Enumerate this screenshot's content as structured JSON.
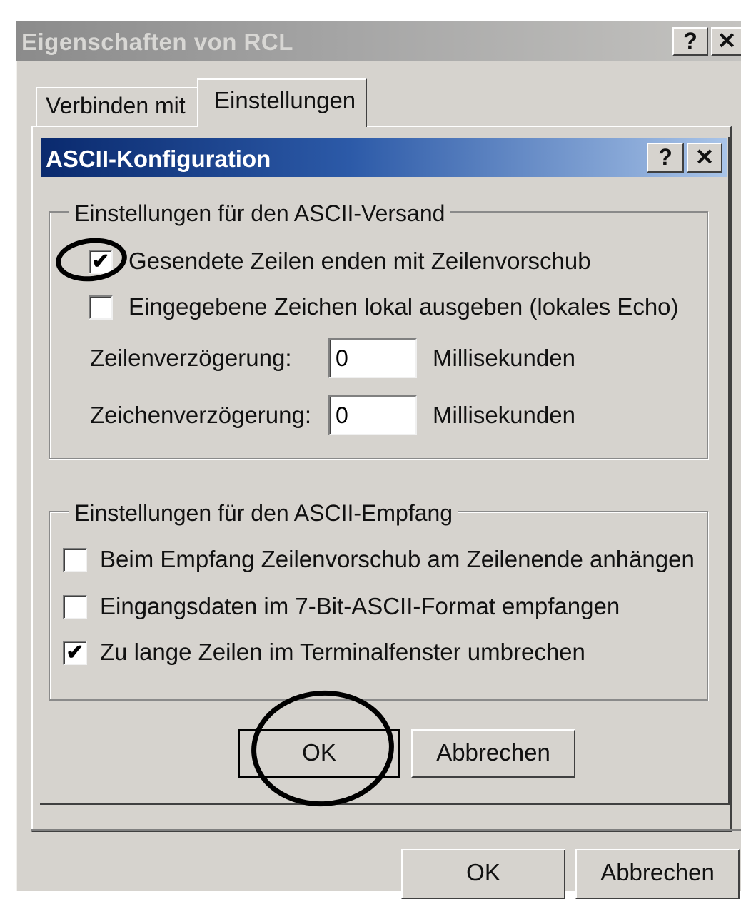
{
  "outer_window": {
    "title": "Eigenschaften von RCL",
    "help_button": "?",
    "close_button": "✕",
    "tabs": [
      {
        "label": "Verbinden mit"
      },
      {
        "label": "Einstellungen"
      }
    ],
    "ok_label": "OK",
    "cancel_label": "Abbrechen"
  },
  "dialog": {
    "title": "ASCII-Konfiguration",
    "help_button": "?",
    "close_button": "✕",
    "send_group": {
      "legend": "Einstellungen für den ASCII-Versand",
      "checkboxes": [
        {
          "label": "Gesendete Zeilen enden mit Zeilenvorschub",
          "checked": true
        },
        {
          "label": "Eingegebene Zeichen lokal ausgeben (lokales Echo)",
          "checked": false
        }
      ],
      "line_delay": {
        "label": "Zeilenverzögerung:",
        "value": "0",
        "unit": "Millisekunden"
      },
      "char_delay": {
        "label": "Zeichenverzögerung:",
        "value": "0",
        "unit": "Millisekunden"
      }
    },
    "receive_group": {
      "legend": "Einstellungen für den ASCII-Empfang",
      "checkboxes": [
        {
          "label": "Beim Empfang Zeilenvorschub am Zeilenende anhängen",
          "checked": false
        },
        {
          "label": "Eingangsdaten im 7-Bit-ASCII-Format empfangen",
          "checked": false
        },
        {
          "label": "Zu lange Zeilen im Terminalfenster umbrechen",
          "checked": true
        }
      ]
    },
    "ok_label": "OK",
    "cancel_label": "Abbrechen"
  },
  "check_glyph": "✔",
  "colors": {
    "window_face": "#d6d3ce",
    "active_title_start": "#0a2a6e",
    "active_title_end": "#a9c4e8",
    "inactive_title": "#8b8b8b",
    "annotation": "#000000"
  }
}
